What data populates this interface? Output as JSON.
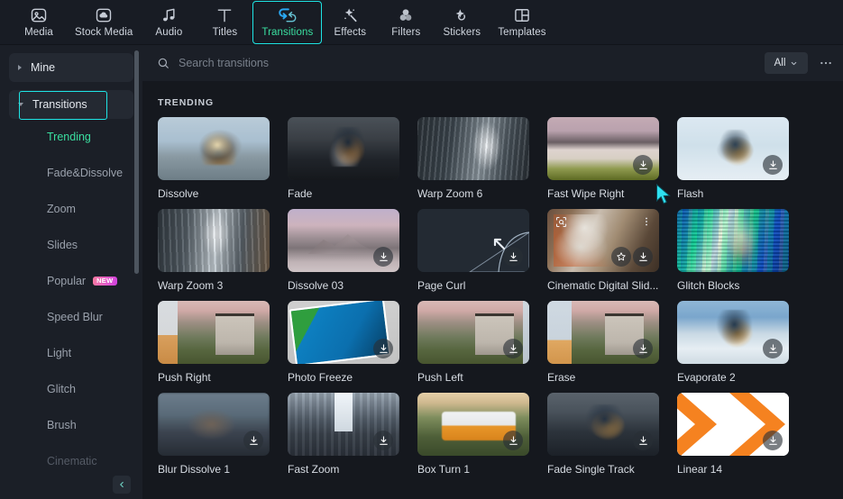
{
  "top_nav": {
    "tabs": [
      {
        "label": "Media",
        "icon": "media-image-icon",
        "active": false
      },
      {
        "label": "Stock Media",
        "icon": "cloud-folder-icon",
        "active": false
      },
      {
        "label": "Audio",
        "icon": "music-note-icon",
        "active": false
      },
      {
        "label": "Titles",
        "icon": "text-t-icon",
        "active": false
      },
      {
        "label": "Transitions",
        "icon": "transitions-arrows-icon",
        "active": true
      },
      {
        "label": "Effects",
        "icon": "sparkle-wand-icon",
        "active": false
      },
      {
        "label": "Filters",
        "icon": "color-circles-icon",
        "active": false
      },
      {
        "label": "Stickers",
        "icon": "sticker-sparkle-icon",
        "active": false
      },
      {
        "label": "Templates",
        "icon": "layout-grid-icon",
        "active": false
      }
    ]
  },
  "sidebar": {
    "pills": [
      {
        "label": "Mine",
        "expanded": false,
        "selected": false
      },
      {
        "label": "Transitions",
        "expanded": true,
        "selected": true
      }
    ],
    "items": [
      {
        "label": "Trending",
        "active": true,
        "badge": null,
        "dim": false
      },
      {
        "label": "Fade&Dissolve",
        "active": false,
        "badge": null,
        "dim": false
      },
      {
        "label": "Zoom",
        "active": false,
        "badge": null,
        "dim": false
      },
      {
        "label": "Slides",
        "active": false,
        "badge": null,
        "dim": false
      },
      {
        "label": "Popular",
        "active": false,
        "badge": "NEW",
        "dim": false
      },
      {
        "label": "Speed Blur",
        "active": false,
        "badge": null,
        "dim": false
      },
      {
        "label": "Light",
        "active": false,
        "badge": null,
        "dim": false
      },
      {
        "label": "Glitch",
        "active": false,
        "badge": null,
        "dim": false
      },
      {
        "label": "Brush",
        "active": false,
        "badge": null,
        "dim": false
      },
      {
        "label": "Cinematic",
        "active": false,
        "badge": null,
        "dim": true
      }
    ],
    "collapse_icon": "chevron-left-icon"
  },
  "search": {
    "placeholder": "Search transitions",
    "value": "",
    "icon": "search-icon"
  },
  "filter": {
    "selected": "All",
    "icon": "chevron-down-icon"
  },
  "more_menu": {
    "icon": "ellipsis-horizontal-icon"
  },
  "content": {
    "section_title": "TRENDING",
    "cards": [
      {
        "label": "Dissolve",
        "art": "art-snow1",
        "download": false,
        "hovered": false
      },
      {
        "label": "Fade",
        "art": "art-dark1",
        "download": false,
        "hovered": false
      },
      {
        "label": "Warp Zoom 6",
        "art": "art-city-warp",
        "download": false,
        "hovered": false
      },
      {
        "label": "Fast Wipe Right",
        "art": "art-blur-field",
        "download": true,
        "hovered": false
      },
      {
        "label": "Flash",
        "art": "art-snowboard-white",
        "download": true,
        "hovered": false
      },
      {
        "label": "Warp Zoom 3",
        "art": "art-city-warp3",
        "download": false,
        "hovered": false
      },
      {
        "label": "Dissolve 03",
        "art": "art-mountain-pink",
        "download": true,
        "hovered": false
      },
      {
        "label": "Page Curl",
        "art": "art-pagecurl",
        "download": true,
        "hovered": false
      },
      {
        "label": "Cinematic Digital Slid...",
        "art": "art-guitar",
        "download": true,
        "hovered": true
      },
      {
        "label": "Glitch Blocks",
        "art": "art-glitch",
        "download": false,
        "hovered": false
      },
      {
        "label": "Push Right",
        "art": "art-house",
        "download": false,
        "hovered": false
      },
      {
        "label": "Photo Freeze",
        "art": "art-photofreeze",
        "download": true,
        "hovered": false
      },
      {
        "label": "Push Left",
        "art": "art-house",
        "download": true,
        "hovered": false
      },
      {
        "label": "Erase",
        "art": "art-house",
        "download": true,
        "hovered": false
      },
      {
        "label": "Evaporate 2",
        "art": "art-evaporate",
        "download": true,
        "hovered": false
      },
      {
        "label": "Blur Dissolve 1",
        "art": "art-blurboard",
        "download": true,
        "hovered": false
      },
      {
        "label": "Fast Zoom",
        "art": "art-citystreet",
        "download": true,
        "hovered": false
      },
      {
        "label": "Box Turn 1",
        "art": "art-bus",
        "download": true,
        "hovered": false
      },
      {
        "label": "Fade Single Track",
        "art": "art-fadesingle",
        "download": true,
        "hovered": false
      },
      {
        "label": "Linear 14",
        "art": "art-linear14",
        "download": true,
        "hovered": false
      }
    ],
    "card_icons": {
      "download": "download-circle-icon",
      "favorite": "star-icon",
      "preview": "preview-scan-icon",
      "kebab": "more-vertical-icon"
    }
  },
  "cursor": {
    "icon": "arrow-pointer-icon",
    "color": "#2ee0f0"
  },
  "colors": {
    "accent_cyan": "#1ee5e5",
    "accent_green": "#3adfa0",
    "accent_blue": "#2aa6f0",
    "bg_top_nav": "#181c24",
    "bg_sidebar": "#1b1f27",
    "bg_main": "#15181e",
    "badge_new": "#e45cc8"
  }
}
